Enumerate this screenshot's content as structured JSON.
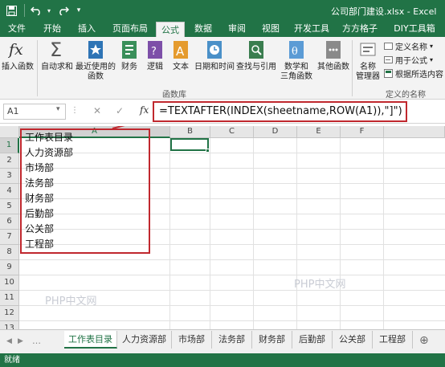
{
  "window": {
    "title": "公司部门建设.xlsx - Excel",
    "accent_color": "#217346"
  },
  "quick_access": {
    "save_icon": "save-icon",
    "undo_icon": "undo-icon",
    "redo_icon": "redo-icon",
    "customize_icon": "customize-icon"
  },
  "ribbon_tabs": [
    {
      "label": "文件"
    },
    {
      "label": "开始"
    },
    {
      "label": "插入"
    },
    {
      "label": "页面布局"
    },
    {
      "label": "公式",
      "active": true
    },
    {
      "label": "数据"
    },
    {
      "label": "审阅"
    },
    {
      "label": "视图"
    },
    {
      "label": "开发工具"
    },
    {
      "label": "方方格子"
    },
    {
      "label": "DIY工具箱"
    }
  ],
  "ribbon": {
    "insert_function": "插入函数",
    "autosum": "自动求和",
    "recent_line1": "最近使用的",
    "recent_line2": "函数",
    "financial": "财务",
    "logical": "逻辑",
    "text": "文本",
    "datetime": "日期和时间",
    "lookup": "查找与引用",
    "math_line1": "数学和",
    "math_line2": "三角函数",
    "other": "其他函数",
    "name_mgr_line1": "名称",
    "name_mgr_line2": "管理器",
    "define_name": "定义名称",
    "use_in_formula": "用于公式",
    "create_from_selection": "根据所选内容",
    "group_library": "函数库",
    "group_names": "定义的名称"
  },
  "formula_bar": {
    "name_box": "A1",
    "fx": "fx",
    "formula": "=TEXTAFTER(INDEX(sheetname,ROW(A1)),\"]\")"
  },
  "columns": [
    "A",
    "B",
    "C",
    "D",
    "E",
    "F"
  ],
  "rows": [
    "1",
    "2",
    "3",
    "4",
    "5",
    "6",
    "7",
    "8",
    "9",
    "10",
    "11",
    "12",
    "13"
  ],
  "cells": [
    "工作表目录",
    "人力资源部",
    "市场部",
    "法务部",
    "财务部",
    "后勤部",
    "公关部",
    "工程部"
  ],
  "watermark": "PHP中文网",
  "sheet_tabs": [
    {
      "label": "工作表目录",
      "active": true
    },
    {
      "label": "人力资源部"
    },
    {
      "label": "市场部"
    },
    {
      "label": "法务部"
    },
    {
      "label": "财务部"
    },
    {
      "label": "后勤部"
    },
    {
      "label": "公关部"
    },
    {
      "label": "工程部"
    }
  ],
  "status": "就绪",
  "highlight_color": "#c0282e"
}
